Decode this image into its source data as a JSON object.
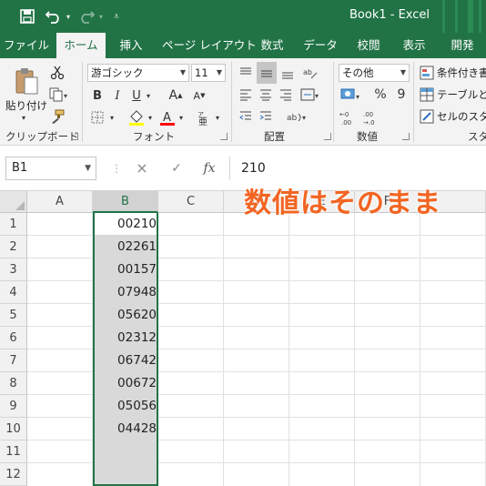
{
  "window": {
    "title": "Book1  -  Excel"
  },
  "quick_access": {
    "save_icon": "save-icon",
    "undo_icon": "undo-icon",
    "redo_icon": "redo-icon",
    "customize_icon": "customize-icon"
  },
  "tabs": [
    {
      "label": "ファイル",
      "active": false
    },
    {
      "label": "ホーム",
      "active": true
    },
    {
      "label": "挿入",
      "active": false
    },
    {
      "label": "ページ レイアウト",
      "active": false
    },
    {
      "label": "数式",
      "active": false
    },
    {
      "label": "データ",
      "active": false
    },
    {
      "label": "校閲",
      "active": false
    },
    {
      "label": "表示",
      "active": false
    },
    {
      "label": "開発",
      "active": false
    }
  ],
  "ribbon": {
    "clipboard": {
      "label": "クリップボード",
      "paste_label": "貼り付け"
    },
    "font": {
      "label": "フォント",
      "font_name": "游ゴシック",
      "font_size": "11",
      "bold": "B",
      "italic": "I",
      "underline": "U",
      "grow": "A",
      "shrink": "A",
      "fill_color": "#FFFF00",
      "font_color": "#FF0000"
    },
    "alignment": {
      "label": "配置"
    },
    "number": {
      "label": "数値",
      "format": "その他",
      "percent": "%",
      "comma": "9"
    },
    "styles": {
      "conditional": "条件付き書",
      "table": "テーブルとし",
      "cell": "セルのスタイ",
      "label": "スタ"
    }
  },
  "formula_bar": {
    "name_box": "B1",
    "cancel_icon": "×",
    "enter_icon": "✓",
    "fx": "fx",
    "formula": "210"
  },
  "sheet": {
    "columns": [
      "A",
      "B",
      "C",
      "D",
      "E",
      "F"
    ],
    "selected_column": "B",
    "rows": [
      "1",
      "2",
      "3",
      "4",
      "5",
      "6",
      "7",
      "8",
      "9",
      "10",
      "11",
      "12"
    ],
    "b_values": [
      "00210",
      "02261",
      "00157",
      "07948",
      "05620",
      "02312",
      "06742",
      "00672",
      "05056",
      "04428",
      "",
      ""
    ]
  },
  "annotation": {
    "text": "数値はそのまま",
    "color": "#F26522"
  },
  "colors": {
    "excel_green": "#217346",
    "ribbon_bg": "#F3F3F3",
    "selection_border": "#217346"
  }
}
